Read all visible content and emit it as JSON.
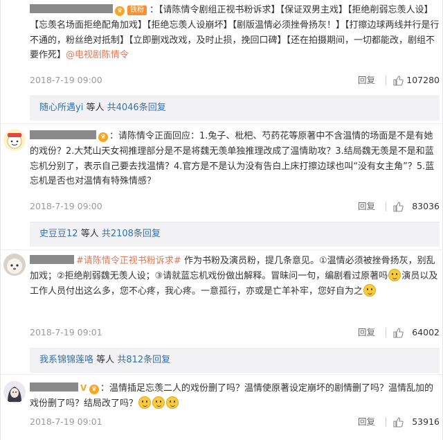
{
  "comments": [
    {
      "badge": "铁粉",
      "text": "：【请陈情令剧组正视书粉诉求】【保证双男主戏】【拒绝削弱忘羡人设】【忘羡名场面拒绝配角加戏】【拒绝忘羡人设崩坏】【剧版温情必须挫骨扬灰！】【打擦边球两线并行是行不通的，粉丝绝对抵制】【立即删戏改戏，及时止损，挽回口碑】【还在拍摄期间，一切都能改，剧组不要作死】",
      "mention": "@电视剧陈情令",
      "date": "2018-7-19 09:00",
      "reply_label": "回复",
      "likes": "107280",
      "replies": {
        "user": "随心所遇yi",
        "middle": "等人",
        "count": "共4046条回复"
      }
    },
    {
      "text": "：请陈情令正面回应：1.兔子、枇杷、芍药花等原著中不含温情的场面是不是有她的戏份？2.大梵山天女祠推理部分是不是将魏无羡单独推理改成了温情助攻？3.结局魏无羡是不是和蓝忘机分别了，表示自己要去找温情？4.官方是不是认为没有告白上床打擦边球也叫“没有女主角”？5.蓝忘机是否也对温情有特殊情感？",
      "date": "2018-7-19 09:00",
      "reply_label": "回复",
      "likes": "83036",
      "replies": {
        "user": "史豆豆12",
        "middle": "等人",
        "count": "共2108条回复"
      }
    },
    {
      "hashtag": "#请陈情令正视书粉诉求#",
      "text_a": "作为书粉及演员粉，提几条意见。①温情必须被挫骨扬灰，别乱加戏；②拒绝削弱魏无羡人设；③请就蓝忘机戏份做出解释。冒昧问一句，编剧看过原著吗",
      "text_b": "演员以及工作人员付出这么多，您不心疼，我心疼。一意孤行，亦或是亡羊补牢，您好自为之",
      "date": "2018-7-19 09:01",
      "reply_label": "回复",
      "likes": "64002",
      "replies": {
        "user": "我系锦锦莲咯",
        "middle": "等人",
        "count": "共812条回复"
      }
    },
    {
      "text": "：温情插足忘羡二人的戏份删了吗？温情使原著设定崩坏的剧情删了吗？温情乱加的戏份删了吗？结局改了吗？",
      "date": "2018-7-19 09:01",
      "reply_label": "回复",
      "likes": "53916"
    }
  ],
  "icons": {
    "like": "thumbs-up-icon",
    "verified": "v-icon",
    "member": "crown-icon"
  },
  "colors": {
    "link": "#eb7350",
    "user_link": "#2f72b7",
    "reply_bg": "#f2f2f5"
  }
}
